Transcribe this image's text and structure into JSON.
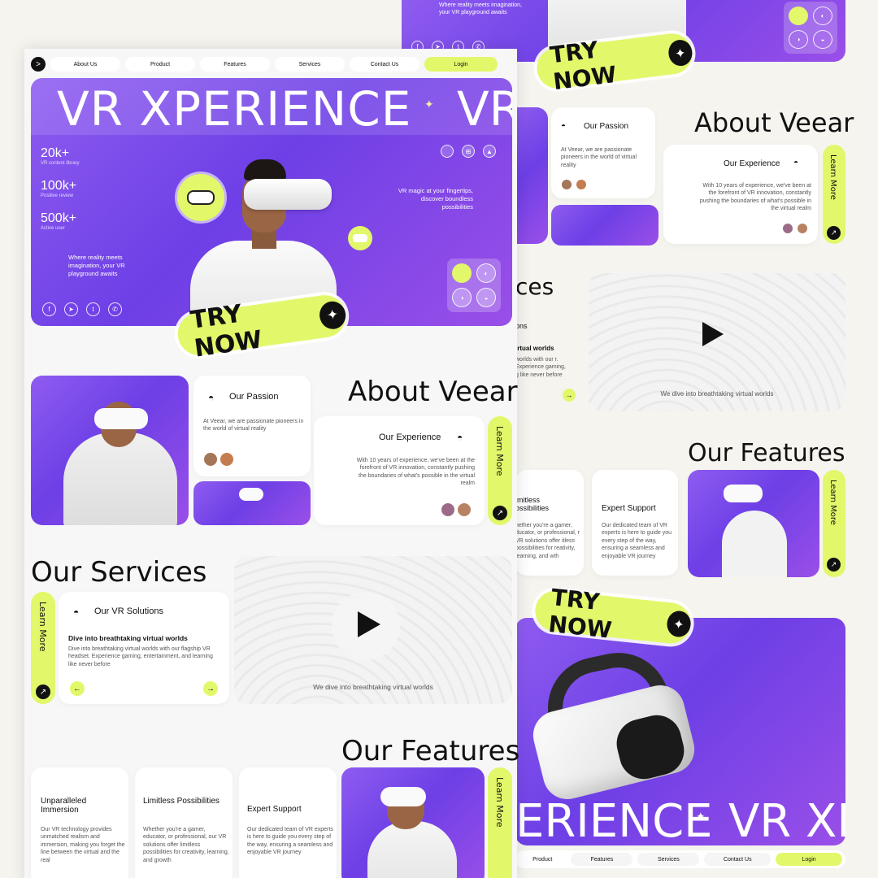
{
  "nav": {
    "items": [
      "About Us",
      "Product",
      "Features",
      "Services",
      "Contact Us"
    ],
    "login": "Login"
  },
  "hero": {
    "title": "VR XPERIENCE",
    "title_repeat": "VR",
    "stats": [
      {
        "value": "20k+",
        "label": "VR content library"
      },
      {
        "value": "100k+",
        "label": "Positive review"
      },
      {
        "value": "500k+",
        "label": "Active user"
      }
    ],
    "tagline_left": "Where reality meets imagination, your VR playground awaits",
    "tagline_right": "VR magic at your fingertips, discover boundless possibilities",
    "cta": "TRY NOW"
  },
  "about": {
    "title": "About Veear",
    "passion_title": "Our Passion",
    "passion_text": "At Veear, we are passionate pioneers in the world of virtual reality",
    "experience_title": "Our Experience",
    "experience_text": "With 10 years of experience, we've been at the forefront of VR innovation, constantly pushing the boundaries of what's possible in the virtual realm",
    "learn_more": "Learn More"
  },
  "services": {
    "title": "Our Services",
    "solutions_title": "Our VR Solutions",
    "solutions_subtitle": "Dive into breathtaking virtual worlds",
    "solutions_text": "Dive into breathtaking virtual worlds with our flagship VR headset. Experience gaming, entertainment, and learning like never before",
    "video_caption": "We dive into breathtaking virtual worlds",
    "learn_more": "Learn More",
    "partial_title": "ces",
    "partial_label": "ons",
    "partial_subtitle": "irtual worlds",
    "partial_text": "worlds with our r. Experience gaming, g like never before"
  },
  "features": {
    "title": "Our Features",
    "items": [
      {
        "title": "Unparalleled Immersion",
        "text": "Our VR technology provides unmatched realism and immersion, making you forget the line between the virtual and the real"
      },
      {
        "title": "Limitless Possibilities",
        "text": "Whether you're a gamer, educator, or professional, our VR solutions offer limitless possibilities for creativity, learning, and growth"
      },
      {
        "title": "Expert Support",
        "text": "Our dedicated team of VR experts is here to guide you every step of the way, ensuring a seamless and enjoyable VR journey"
      }
    ],
    "learn_more": "Learn More",
    "partial_limitless_title": "imitless ossibilities",
    "partial_limitless_text": "hether you're a gamer, ducator, or professional, r VR solutions offer itless possibilities for reativity, learning, and wth"
  },
  "right_top": {
    "tagline": "Where reality meets imagination, your VR playground awaits",
    "cta": "TRY NOW"
  },
  "right_bottom": {
    "cta": "TRY NOW",
    "banner_text": "ERIENCE",
    "banner_text2": "VR XI",
    "nav_items": [
      "Product",
      "Features",
      "Services",
      "Contact Us"
    ],
    "login": "Login"
  },
  "colors": {
    "accent": "#e3f76a",
    "purple": "#7b4ae8",
    "dark": "#111111"
  }
}
